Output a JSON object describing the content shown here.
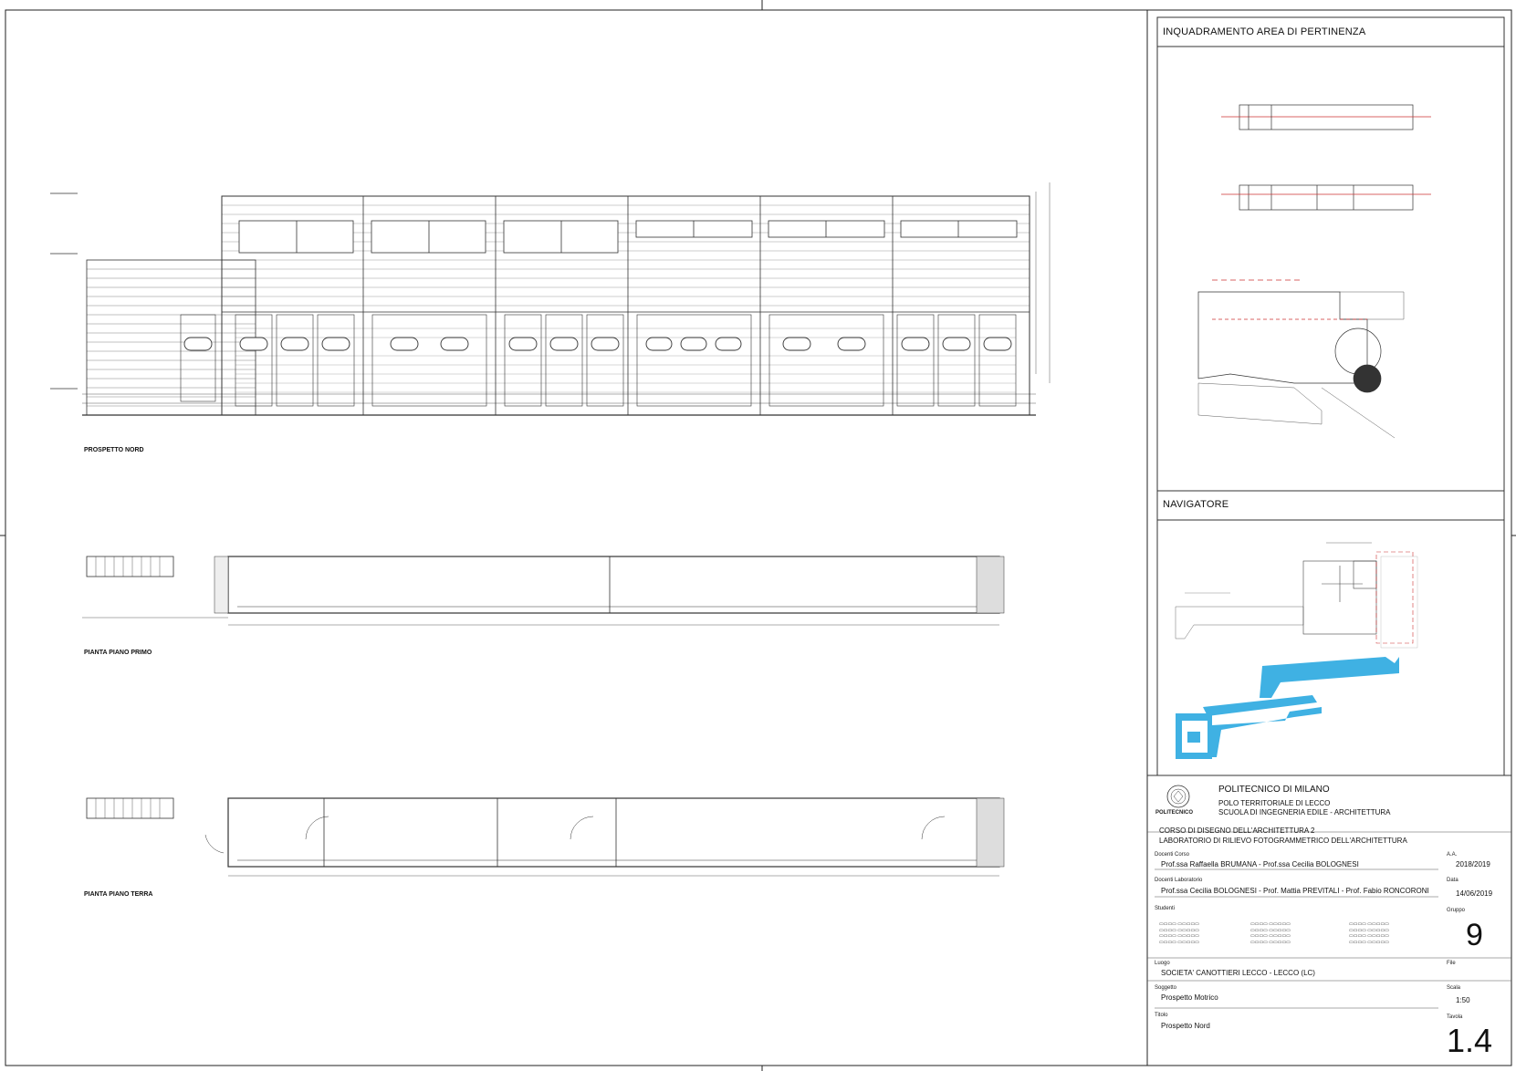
{
  "sidebar": {
    "area_title": "INQUADRAMENTO AREA DI PERTINENZA",
    "navigator_title": "NAVIGATORE"
  },
  "drawings": {
    "elevation_label": "PROSPETTO NORD",
    "first_floor_label": "PIANTA PIANO PRIMO",
    "ground_floor_label": "PIANTA PIANO TERRA"
  },
  "title_block": {
    "university": "POLITECNICO DI MILANO",
    "logo_text": "POLITECNICO",
    "campus": "POLO TERRITORIALE DI LECCO",
    "school": "SCUOLA DI INGEGNERIA EDILE - ARCHITETTURA",
    "course": "CORSO DI DISEGNO DELL'ARCHITETTURA 2",
    "lab": "LABORATORIO DI RILIEVO FOTOGRAMMETRICO DELL'ARCHITETTURA",
    "course_teachers_label": "Docenti Corso",
    "course_teachers": "Prof.ssa Raffaella BRUMANA - Prof.ssa Cecilia BOLOGNESI",
    "aa_label": "A.A.",
    "aa_value": "2018/2019",
    "lab_teachers_label": "Docenti Laboratorio",
    "lab_teachers": "Prof.ssa Cecilia BOLOGNESI - Prof. Mattia PREVITALI - Prof. Fabio RONCORONI",
    "date_label": "Data",
    "date_value": "14/06/2019",
    "students_label": "Studenti",
    "group_label": "Gruppo",
    "group_value": "9",
    "place_label": "Luogo",
    "place_value": "SOCIETA' CANOTTIERI LECCO - LECCO (LC)",
    "file_label": "File",
    "subject_label": "Soggetto",
    "subject_value": "Prospetto Motrico",
    "scale_label": "Scala",
    "scale_value": "1:50",
    "title_label": "Titolo",
    "title_value": "Prospetto Nord",
    "sheet_label": "Tavola",
    "sheet_value": "1.4"
  }
}
